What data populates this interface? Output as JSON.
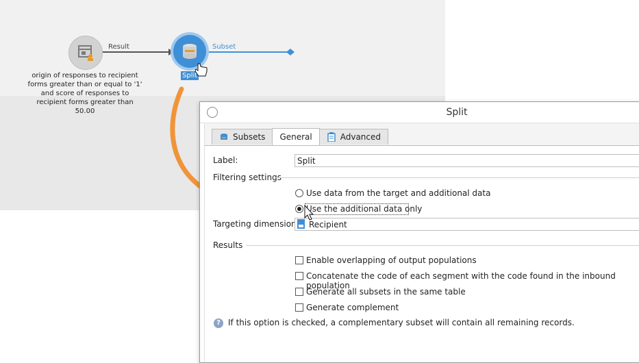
{
  "workflow": {
    "query_node_description": "origin of responses to recipient forms greater than or equal to '1' and score of responses to recipient forms greater than 50.00",
    "transition_result_label": "Result",
    "split_node_label": "Split",
    "transition_subset_label": "Subset"
  },
  "dialog": {
    "title": "Split",
    "tabs": [
      {
        "label": "Subsets",
        "icon": "subsets-icon"
      },
      {
        "label": "General",
        "icon": ""
      },
      {
        "label": "Advanced",
        "icon": "clipboard-icon"
      }
    ],
    "active_tab": "General",
    "label_caption": "Label:",
    "label_value": "Split",
    "filtering_settings_heading": "Filtering settings",
    "radio_target_and_additional": "Use data from the target and additional data",
    "radio_additional_only": "Use the additional data only",
    "targeting_dimension_caption": "Targeting dimension:",
    "targeting_dimension_value": "Recipient",
    "results_heading": "Results",
    "check_enable_overlapping": "Enable overlapping of output populations",
    "check_concatenate_code": "Concatenate the code of each segment with the code found in the inbound population",
    "check_generate_same_table": "Generate all subsets in the same table",
    "check_generate_complement": "Generate complement",
    "help_text": "If this option is checked, a complementary subset will contain all remaining records."
  },
  "colors": {
    "accent_blue": "#3f8fd6",
    "annotation_arrow": "#f0943a"
  }
}
